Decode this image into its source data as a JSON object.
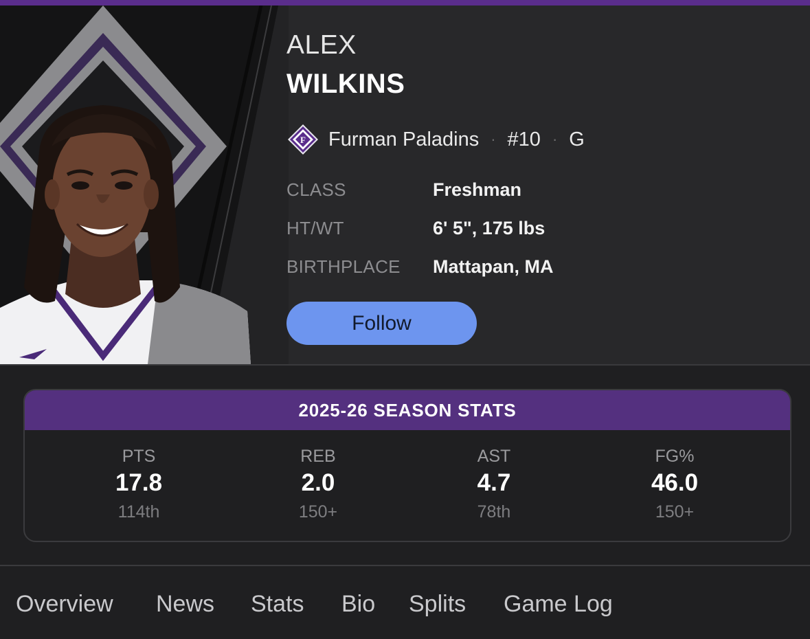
{
  "player": {
    "first_name": "ALEX",
    "last_name": "WILKINS",
    "team": "Furman Paladins",
    "team_logo_icon": "paladin-shield-icon",
    "number": "#10",
    "position": "G",
    "separator": "·",
    "attributes": [
      {
        "label": "CLASS",
        "value": "Freshman"
      },
      {
        "label": "HT/WT",
        "value": "6' 5\", 175 lbs"
      },
      {
        "label": "BIRTHPLACE",
        "value": "Mattapan, MA"
      }
    ],
    "follow_label": "Follow"
  },
  "season_stats": {
    "title": "2025-26 SEASON STATS",
    "stats": [
      {
        "label": "PTS",
        "value": "17.8",
        "rank": "114th"
      },
      {
        "label": "REB",
        "value": "2.0",
        "rank": "150+"
      },
      {
        "label": "AST",
        "value": "4.7",
        "rank": "78th"
      },
      {
        "label": "FG%",
        "value": "46.0",
        "rank": "150+"
      }
    ]
  },
  "tabs": [
    {
      "label": "Overview"
    },
    {
      "label": "News"
    },
    {
      "label": "Stats"
    },
    {
      "label": "Bio"
    },
    {
      "label": "Splits"
    },
    {
      "label": "Game Log"
    }
  ],
  "colors": {
    "accent_purple": "#54307f",
    "follow_blue": "#6d95ef",
    "background": "#1f1f21"
  }
}
